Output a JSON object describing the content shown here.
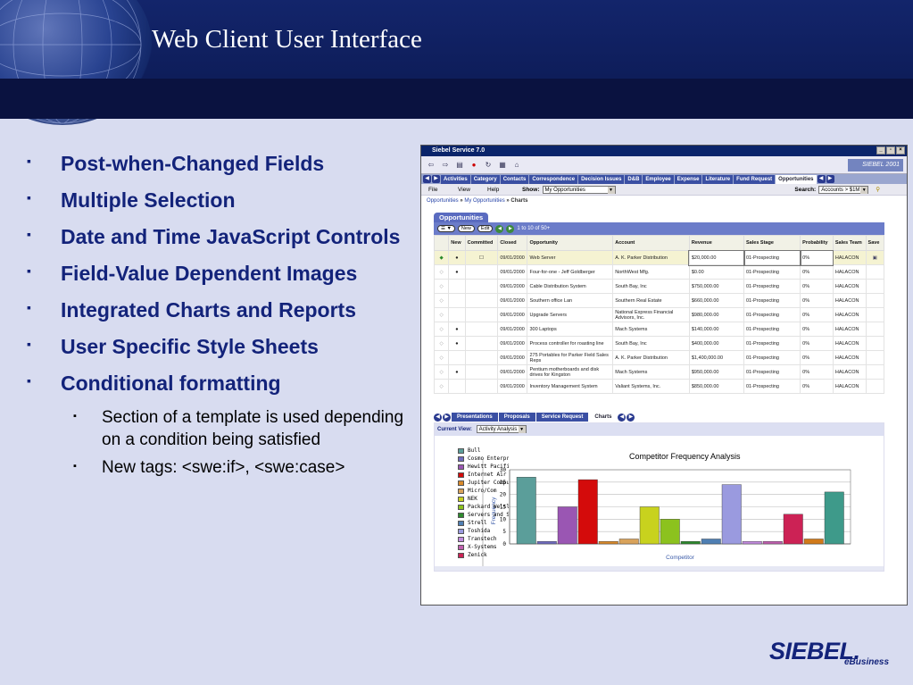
{
  "slide": {
    "title": "Web Client User Interface",
    "bullets": [
      "Post-when-Changed Fields",
      "Multiple Selection",
      "Date and Time JavaScript Controls",
      "Field-Value Dependent Images",
      "Integrated Charts and Reports",
      "User Specific Style Sheets",
      "Conditional formatting"
    ],
    "sub_bullets": [
      "Section of a template is used depending on a condition being satisfied",
      "New tags: <swe:if>, <swe:case>"
    ],
    "logo": "SIEBEL.",
    "logo_sub": "eBusiness"
  },
  "app": {
    "window_title": "Siebel Service 7.0",
    "brand": "SIEBEL 2001",
    "tabs": [
      "Activities",
      "Category",
      "Contacts",
      "Correspondence",
      "Decision Issues",
      "D&B",
      "Employee",
      "Expense",
      "Literature",
      "Fund Request",
      "Opportunities"
    ],
    "active_tab": "Opportunities",
    "menu": [
      "File",
      "View",
      "Help"
    ],
    "show_label": "Show:",
    "show_value": "My Opportunities",
    "search_label": "Search:",
    "search_value": "Accounts > $1M",
    "breadcrumb_1": "Opportunities",
    "breadcrumb_2": "My Opportunities",
    "breadcrumb_3": "Charts",
    "breadcrumb_sep": "»",
    "applet_title": "Opportunities",
    "new_label": "New",
    "edit_label": "Edit",
    "record_count": "1 to 10 of 50+",
    "columns": [
      "New",
      "Committed",
      "Closed",
      "Opportunity",
      "Account",
      "Revenue",
      "Sales Stage",
      "Probability",
      "Sales Team",
      "Save"
    ],
    "rows": [
      {
        "new": "●",
        "closed": "09/01/2000",
        "opp": "Web Server",
        "account": "A. K. Parker Distribution",
        "revenue": "$20,000.00",
        "stage": "01-Prospecting",
        "prob": "0%",
        "team": "HALACON"
      },
      {
        "new": "●",
        "closed": "09/01/2000",
        "opp": "Four-for-one - Jeff Goldberger",
        "account": "NorthWest Mfg.",
        "revenue": "$0.00",
        "stage": "01-Prospecting",
        "prob": "0%",
        "team": "HALACON"
      },
      {
        "new": "",
        "closed": "09/01/2000",
        "opp": "Cable Distribution System",
        "account": "South Bay, Inc",
        "revenue": "$750,000.00",
        "stage": "01-Prospecting",
        "prob": "0%",
        "team": "HALACON"
      },
      {
        "new": "",
        "closed": "09/01/2000",
        "opp": "Southern office Lan",
        "account": "Southern Real Estate",
        "revenue": "$660,000.00",
        "stage": "01-Prospecting",
        "prob": "0%",
        "team": "HALACON"
      },
      {
        "new": "",
        "closed": "09/01/2000",
        "opp": "Upgrade Servers",
        "account": "National Express Financial Advisors, Inc.",
        "revenue": "$980,000.00",
        "stage": "01-Prospecting",
        "prob": "0%",
        "team": "HALACON"
      },
      {
        "new": "●",
        "closed": "09/01/2000",
        "opp": "300 Laptops",
        "account": "Mach Systems",
        "revenue": "$140,000.00",
        "stage": "01-Prospecting",
        "prob": "0%",
        "team": "HALACON"
      },
      {
        "new": "●",
        "closed": "09/01/2000",
        "opp": "Process controller for roasting line",
        "account": "South Bay, Inc",
        "revenue": "$400,000.00",
        "stage": "01-Prospecting",
        "prob": "0%",
        "team": "HALACON"
      },
      {
        "new": "",
        "closed": "09/01/2000",
        "opp": "275 Portables for Parker Field Sales Reps",
        "account": "A. K. Parker Distribution",
        "revenue": "$1,400,000.00",
        "stage": "01-Prospecting",
        "prob": "0%",
        "team": "HALACON"
      },
      {
        "new": "●",
        "closed": "09/01/2000",
        "opp": "Pentium motherboards and disk drives for Kingston",
        "account": "Mach Systems",
        "revenue": "$950,000.00",
        "stage": "01-Prospecting",
        "prob": "0%",
        "team": "HALACON"
      },
      {
        "new": "",
        "closed": "09/01/2000",
        "opp": "Inventory Management System",
        "account": "Valiant Systems, Inc.",
        "revenue": "$850,000.00",
        "stage": "01-Prospecting",
        "prob": "0%",
        "team": "HALACON"
      }
    ],
    "chart_tabs": [
      "Presentations",
      "Proposals",
      "Service Request",
      "Charts"
    ],
    "active_chart_tab": "Charts",
    "current_view_label": "Current View:",
    "current_view_value": "Activity Analysis"
  },
  "chart_data": {
    "type": "bar",
    "title": "Competitor Frequency Analysis",
    "xlabel": "Competitor",
    "ylabel": "Frequency",
    "ylim": [
      0,
      30
    ],
    "yticks": [
      "0",
      "5",
      "10",
      "15",
      "20",
      "25",
      "30"
    ],
    "grid": true,
    "legend_position": "left",
    "categories": [
      "Bull",
      "Cosmo Enterpr",
      "Hewitt Pacific",
      "Internet Air",
      "Jupiter Comput",
      "Micro/Com",
      "NEK",
      "Packard Welsle",
      "Servers and S-",
      "Strell",
      "Toshida",
      "Transtech",
      "X-Systems",
      "Zenick"
    ],
    "values": [
      27,
      1,
      15,
      26,
      1,
      2,
      15,
      10,
      1,
      2,
      24,
      1,
      1,
      12,
      2,
      21
    ],
    "bar_values": [
      27,
      1,
      15,
      26,
      1,
      2,
      15,
      10,
      1,
      2,
      24,
      1,
      1,
      12,
      2,
      21
    ],
    "colors": [
      "#5b9e9a",
      "#6f6bbf",
      "#9a56b3",
      "#d40b0b",
      "#d98a2b",
      "#d9a35b",
      "#c8d21e",
      "#8cc21e",
      "#2d8a2d",
      "#4f7fb3",
      "#9a9adf",
      "#c28bdf",
      "#c05fb0",
      "#cc2255",
      "#d17a1a",
      "#3e9a8a"
    ]
  }
}
